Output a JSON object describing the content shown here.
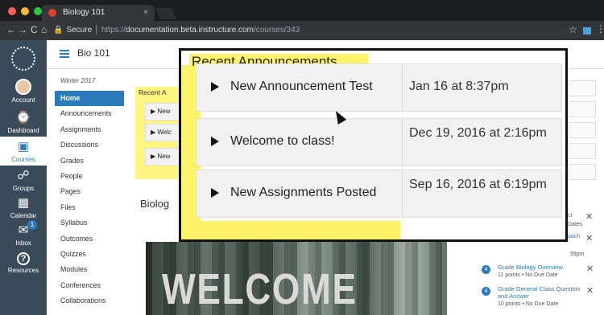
{
  "browser": {
    "tab_title": "Biology 101",
    "tab_close": "×",
    "secure_label": "Secure",
    "url_prefix": "https://",
    "url_host": "documentation.beta.instructure.com",
    "url_path": "/courses/343",
    "back": "←",
    "forward": "→",
    "reload": "C",
    "home": "⌂",
    "star": "☆",
    "menu": "⋮",
    "traffic_colors": [
      "#ff5f57",
      "#febc2e",
      "#28c840"
    ]
  },
  "global_nav": [
    {
      "key": "account",
      "label": "Account"
    },
    {
      "key": "dashboard",
      "label": "Dashboard",
      "icon": "⌚"
    },
    {
      "key": "courses",
      "label": "Courses",
      "icon": "▣"
    },
    {
      "key": "groups",
      "label": "Groups",
      "icon": "☍"
    },
    {
      "key": "calendar",
      "label": "Calendar",
      "icon": "▦"
    },
    {
      "key": "inbox",
      "label": "Inbox",
      "icon": "✉",
      "badge": "1"
    },
    {
      "key": "resources",
      "label": "Resources",
      "icon": "?"
    }
  ],
  "course": {
    "title": "Bio 101",
    "term": "Winter 2017",
    "nav": [
      "Home",
      "Announcements",
      "Assignments",
      "Discussions",
      "Grades",
      "People",
      "Pages",
      "Files",
      "Syllabus",
      "Outcomes",
      "Quizzes",
      "Modules",
      "Conferences",
      "Collaborations"
    ]
  },
  "main": {
    "recent_truncated": "Recent A",
    "rows_truncated": [
      "New",
      "Welc",
      "New"
    ],
    "biology_heading_truncated": "Biolog",
    "welcome_banner": "WELCOME"
  },
  "callout": {
    "title": "Recent Announcements",
    "items": [
      {
        "title": "New Announcement Test",
        "date": "Jan 16 at 8:37pm"
      },
      {
        "title": "Welcome to class!",
        "date": "Dec 19, 2016 at 2:16pm"
      },
      {
        "title": "New Assignments Posted",
        "date": "Sep 16, 2016 at 6:19pm"
      }
    ]
  },
  "todo": {
    "partial_1_title": "ct",
    "partial_1_meta": "Dates",
    "partial_2_title": "oach",
    "partial_3_meta": "59pm",
    "items": [
      {
        "count": "4",
        "title": "Grade Biology Overview",
        "meta": "11 points • No Due Date"
      },
      {
        "count": "4",
        "title": "Grade General Class Question and Answer",
        "meta": "10 points • No Due Date"
      }
    ],
    "close": "✕"
  },
  "colors": {
    "accent": "#2b7abc",
    "global_nav_bg": "#394b58",
    "highlight": "#fff36a"
  }
}
